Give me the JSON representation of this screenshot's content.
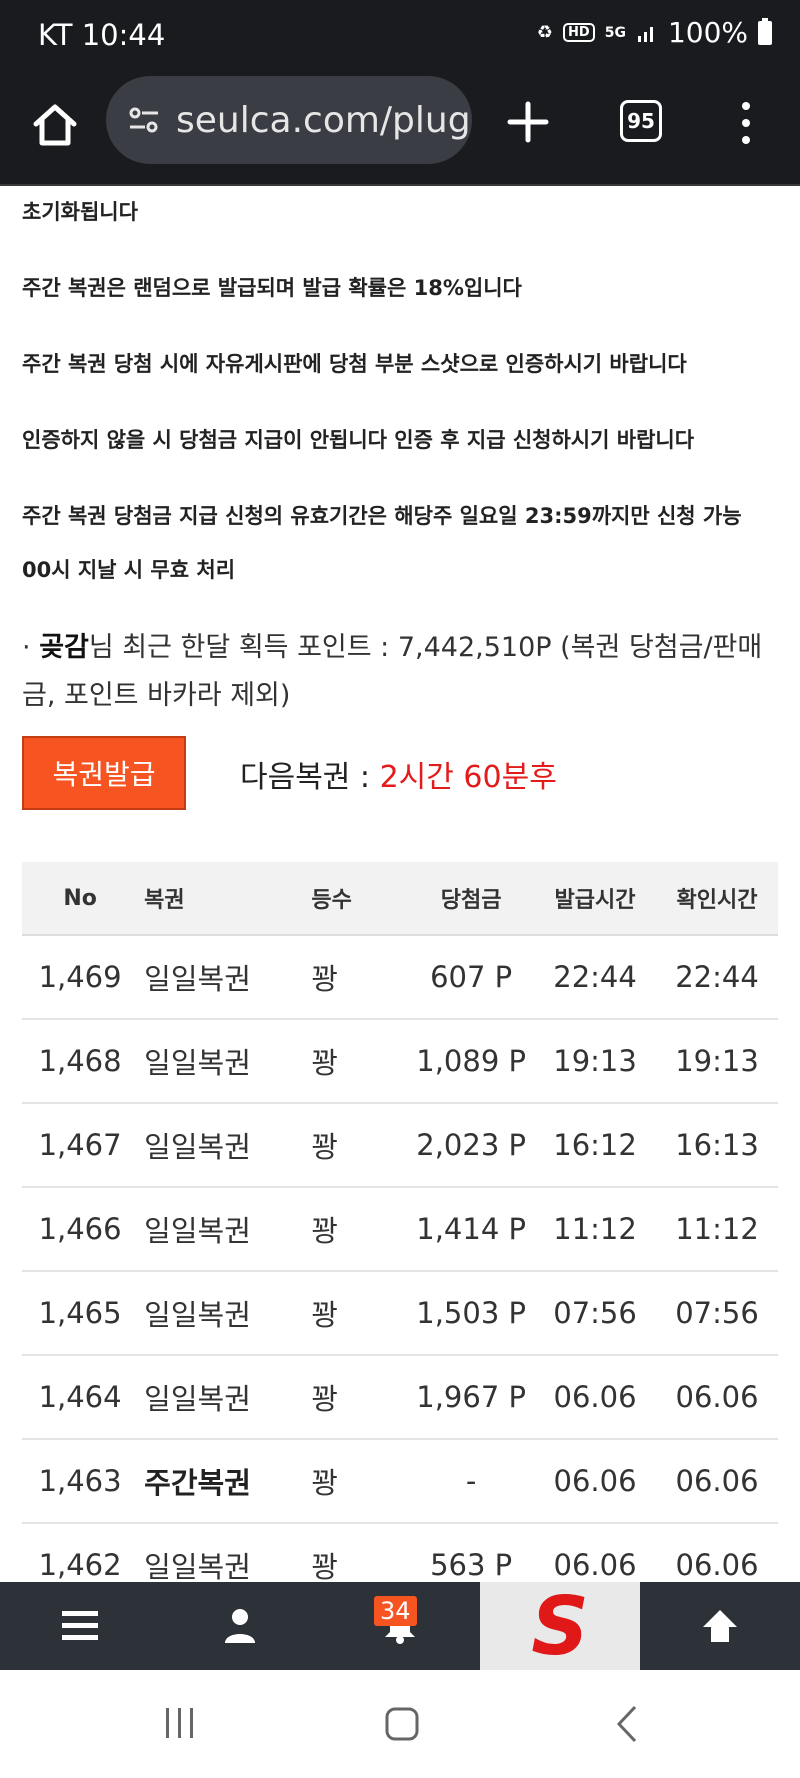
{
  "status_bar": {
    "carrier_time": "KT 10:44",
    "network": "5G",
    "hd": "HD",
    "battery": "100%"
  },
  "browser": {
    "url": "seulca.com/plug",
    "tab_count": "95"
  },
  "notices": [
    "초기화됩니다",
    "주간 복권은 랜덤으로 발급되며 발급 확률은 18%입니다",
    "주간 복권 당첨 시에 자유게시판에 당첨 부분 스샷으로 인증하시기 바랍니다",
    "인증하지 않을 시 당첨금 지급이 안됩니다 인증 후 지급 신청하시기 바랍니다",
    "주간 복권 당첨금 지급 신청의 유효기간은 해당주 일요일 23:59까지만 신청 가능",
    "00시 지날 시 무효 처리"
  ],
  "points": {
    "bullet": "·",
    "user": "곶감",
    "text": "님 최근 한달 획득 포인트 : 7,442,510P (복권 당첨금/판매금, 포인트 바카라 제외)"
  },
  "issue_button": "복권발급",
  "next_lottery": {
    "label": "다음복권 : ",
    "value": "2시간 60분후"
  },
  "table": {
    "headers": [
      "No",
      "복권",
      "등수",
      "당첨금",
      "발급시간",
      "확인시간"
    ],
    "rows": [
      {
        "no": "1,469",
        "name": "일일복권",
        "rank": "꽝",
        "prize": "607 P",
        "issued": "22:44",
        "checked": "22:44"
      },
      {
        "no": "1,468",
        "name": "일일복권",
        "rank": "꽝",
        "prize": "1,089 P",
        "issued": "19:13",
        "checked": "19:13"
      },
      {
        "no": "1,467",
        "name": "일일복권",
        "rank": "꽝",
        "prize": "2,023 P",
        "issued": "16:12",
        "checked": "16:13"
      },
      {
        "no": "1,466",
        "name": "일일복권",
        "rank": "꽝",
        "prize": "1,414 P",
        "issued": "11:12",
        "checked": "11:12"
      },
      {
        "no": "1,465",
        "name": "일일복권",
        "rank": "꽝",
        "prize": "1,503 P",
        "issued": "07:56",
        "checked": "07:56"
      },
      {
        "no": "1,464",
        "name": "일일복권",
        "rank": "꽝",
        "prize": "1,967 P",
        "issued": "06.06",
        "checked": "06.06"
      },
      {
        "no": "1,463",
        "name": "주간복권",
        "rank": "꽝",
        "prize": "-",
        "issued": "06.06",
        "checked": "06.06"
      },
      {
        "no": "1,462",
        "name": "일일복권",
        "rank": "꽝",
        "prize": "563 P",
        "issued": "06.06",
        "checked": "06.06"
      }
    ]
  },
  "site_nav": {
    "notification_count": "34",
    "logo_letter": "S"
  },
  "colors": {
    "accent": "#f65421",
    "next_time": "#e31b1b",
    "nav_bg": "#2d3138"
  }
}
